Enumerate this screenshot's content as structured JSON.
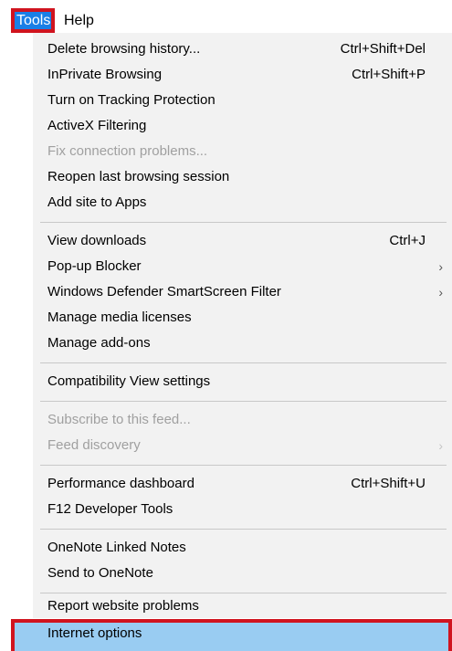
{
  "menubar": {
    "tools_label": "Tools",
    "help_label": "Help"
  },
  "menu": {
    "items": [
      {
        "label": "Delete browsing history...",
        "shortcut": "Ctrl+Shift+Del"
      },
      {
        "label": "InPrivate Browsing",
        "shortcut": "Ctrl+Shift+P"
      },
      {
        "label": "Turn on Tracking Protection"
      },
      {
        "label": "ActiveX Filtering"
      },
      {
        "label": "Fix connection problems...",
        "disabled": true
      },
      {
        "label": "Reopen last browsing session"
      },
      {
        "label": "Add site to Apps"
      },
      {
        "label": "View downloads",
        "shortcut": "Ctrl+J"
      },
      {
        "label": "Pop-up Blocker",
        "arrow": "›"
      },
      {
        "label": "Windows Defender SmartScreen Filter",
        "arrow": "›"
      },
      {
        "label": "Manage media licenses"
      },
      {
        "label": "Manage add-ons"
      },
      {
        "label": "Compatibility View settings"
      },
      {
        "label": "Subscribe to this feed...",
        "disabled": true
      },
      {
        "label": "Feed discovery",
        "disabled": true,
        "arrow": "›"
      },
      {
        "label": "Performance dashboard",
        "shortcut": "Ctrl+Shift+U"
      },
      {
        "label": "F12 Developer Tools"
      },
      {
        "label": "OneNote Linked Notes"
      },
      {
        "label": "Send to OneNote"
      },
      {
        "label": "Report website problems"
      },
      {
        "label": "Internet options",
        "highlighted": true
      }
    ]
  }
}
